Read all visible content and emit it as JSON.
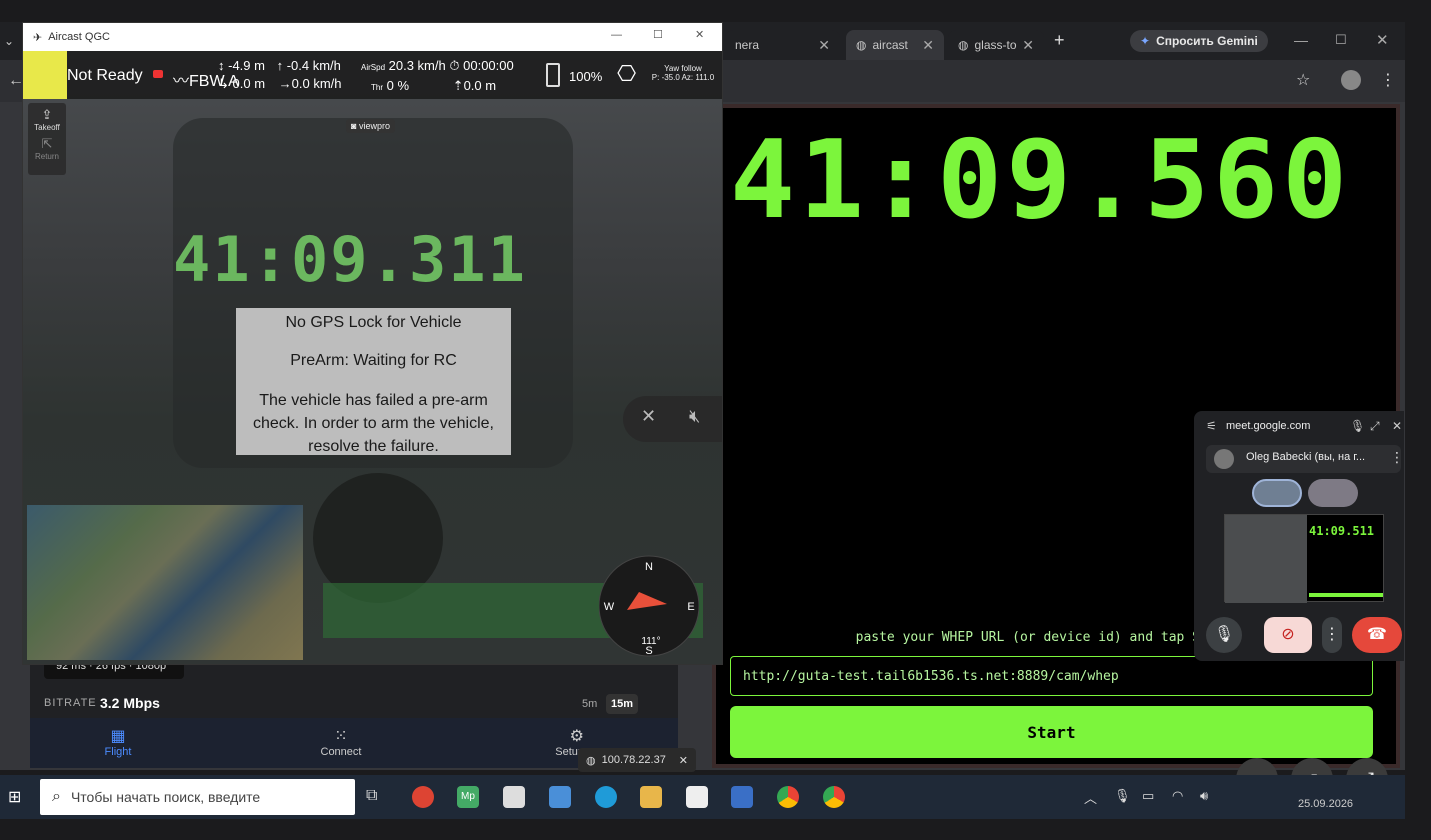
{
  "browser": {
    "tabs": [
      {
        "label": "nera"
      },
      {
        "label": "aircast"
      },
      {
        "label": "glass-to"
      }
    ],
    "new_tab": "+",
    "gemini": "Спросить Gemini"
  },
  "qgc": {
    "window_title": "Aircast QGC",
    "status": "Not Ready",
    "mode": "FBW A",
    "alt_rel": "-4.9 m",
    "climb": "-0.4 km/h",
    "airspd_label": "AirSpd",
    "airspd": "20.3 km/h",
    "flight_time": "00:00:00",
    "dist_home": "0.0 m",
    "groundspeed": "0.0 km/h",
    "thr_label": "Thr",
    "thr": "0 %",
    "dist_wp": "0.0 m",
    "battery": "100%",
    "gimbal_mode": "Yaw follow",
    "gimbal_angles": "P: -35.0 Az: 111.0",
    "takeoff": "Takeoff",
    "return": "Return",
    "camera_tag": "viewpro",
    "cam_clock": "41:09.311",
    "msg1": "No GPS Lock for Vehicle",
    "msg2": "PreArm: Waiting for RC",
    "msg3": "The vehicle has failed a pre-arm check. In order to arm the vehicle, resolve the failure.",
    "compass": {
      "n": "N",
      "s": "S",
      "e": "E",
      "w": "W",
      "heading": "111°"
    }
  },
  "underlay": {
    "stats": "92 ms · 26 fps · 1080p",
    "bitrate_label": "BITRATE",
    "bitrate": "3.2 Mbps",
    "range_5m": "5m",
    "range_15m": "15m",
    "nav": [
      {
        "label": "Flight"
      },
      {
        "label": "Connect"
      },
      {
        "label": "Setup"
      }
    ]
  },
  "page": {
    "clock": "41:09.560",
    "hint": "paste your WHEP URL (or device id) and tap S",
    "url": "http://guta-test.tail6b1536.ts.net:8889/cam/whep",
    "start": "Start"
  },
  "pip": {
    "host": "meet.google.com",
    "participant": "Oleg Babecki (вы, на г...",
    "thumb_clock": "41:09.511"
  },
  "toast": {
    "ip": "100.78.22.37"
  },
  "taskbar": {
    "search_placeholder": "Чтобы начать поиск, введите",
    "date": "25.09.2026"
  },
  "colors": {
    "accent_green": "#7cf53c",
    "end_call": "#e5483b"
  }
}
